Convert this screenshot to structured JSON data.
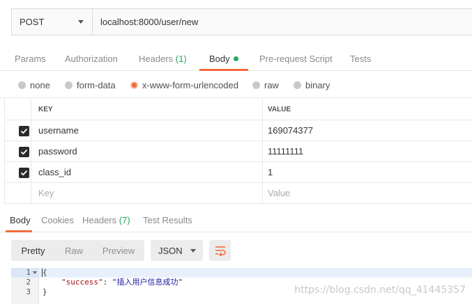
{
  "request": {
    "method": "POST",
    "url": "localhost:8000/user/new"
  },
  "request_tabs": [
    {
      "label": "Params"
    },
    {
      "label": "Authorization"
    },
    {
      "label": "Headers",
      "count": "(1)"
    },
    {
      "label": "Body",
      "active": true
    },
    {
      "label": "Pre-request Script"
    },
    {
      "label": "Tests"
    }
  ],
  "body_types": [
    {
      "label": "none"
    },
    {
      "label": "form-data"
    },
    {
      "label": "x-www-form-urlencoded",
      "selected": true
    },
    {
      "label": "raw"
    },
    {
      "label": "binary"
    }
  ],
  "params_table": {
    "headers": {
      "key": "KEY",
      "value": "VALUE"
    },
    "rows": [
      {
        "key": "username",
        "value": "169074377",
        "checked": true
      },
      {
        "key": "password",
        "value": "11111111",
        "checked": true
      },
      {
        "key": "class_id",
        "value": "1",
        "checked": true
      }
    ],
    "placeholder": {
      "key": "Key",
      "value": "Value"
    }
  },
  "response_tabs": [
    {
      "label": "Body",
      "active": true
    },
    {
      "label": "Cookies"
    },
    {
      "label": "Headers",
      "count": "(7)"
    },
    {
      "label": "Test Results"
    }
  ],
  "response_toolbar": {
    "formats": [
      "Pretty",
      "Raw",
      "Preview"
    ],
    "selected_format": "Pretty",
    "language": "JSON",
    "wrap_icon": "wrap-lines-icon"
  },
  "response_body": {
    "line_numbers": [
      "1",
      "2",
      "3"
    ],
    "lines": {
      "open": "{",
      "key": "\"success\"",
      "colon": ": ",
      "value": "\"插入用户信息成功\"",
      "close": "}"
    }
  },
  "watermark": "https://blog.csdn.net/qq_41445357",
  "colors": {
    "accent": "#f26b3a",
    "count_green": "#26a65b"
  }
}
